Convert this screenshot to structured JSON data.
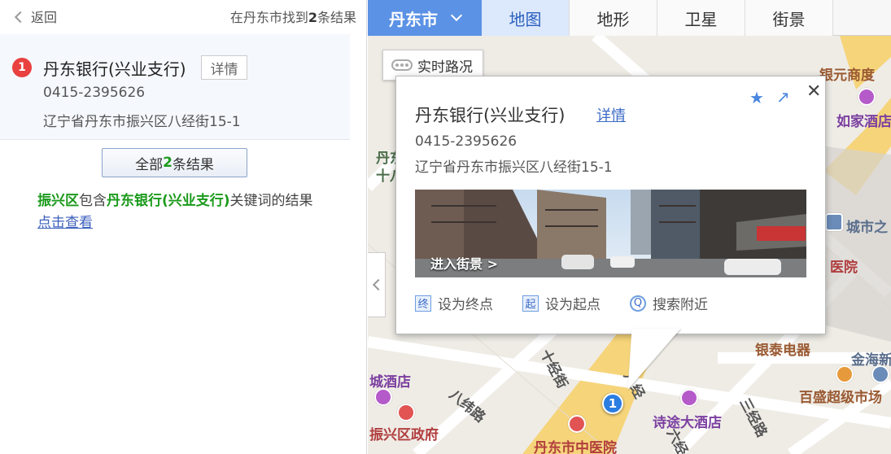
{
  "left_panel": {
    "back_label": "返回",
    "found_prefix": "在丹东市找到",
    "found_count": "2",
    "found_suffix": "条结果"
  },
  "result": {
    "index": "1",
    "name": "丹东银行(兴业支行)",
    "detail_label": "详情",
    "phone": "0415-2395626",
    "address": "辽宁省丹东市振兴区八经街15-1"
  },
  "all_results": {
    "prefix": "全部",
    "count": "2",
    "suffix": "条结果"
  },
  "keyword_note": {
    "district": "振兴区",
    "text1": "包含",
    "keyword": "丹东银行(兴业支行)",
    "text2": "关键词的结果",
    "link": "点击查看"
  },
  "map": {
    "city": "丹东市",
    "tabs": [
      "地图",
      "地形",
      "卫星",
      "街景"
    ],
    "active_tab": "地图",
    "traffic_label": "实时路况",
    "labels": {
      "mall": "银元商度",
      "hotel_rujia": "如家酒店",
      "city_of": "城市之",
      "hospital": "医院",
      "yintai": "银泰电器",
      "jinhai": "金海新",
      "baisheng": "百盛超级市场",
      "city_hotel": "城酒店",
      "zhenxing_gov": "振兴区政府",
      "shitu_hotel": "诗途大酒店",
      "tcm_hospital": "丹东市中医院",
      "dan_fragment": "丹东",
      "shi_fragment": "十八"
    },
    "roads": {
      "shijing": "十经街",
      "bawei": "八纬路",
      "bajing": "八经",
      "sanjing": "三经路",
      "liujing": "六经"
    },
    "marker_label": "1"
  },
  "popup": {
    "name": "丹东银行(兴业支行)",
    "detail_label": "详情",
    "phone": "0415-2395626",
    "address": "辽宁省丹东市振兴区八经街15-1",
    "street_view_label": "进入街景 >",
    "actions": [
      {
        "icon": "终",
        "label": "设为终点"
      },
      {
        "icon": "起",
        "label": "设为起点"
      },
      {
        "icon": "Q",
        "label": "搜索附近"
      }
    ]
  },
  "colors": {
    "city_bg": "#5b92e5",
    "active_tab_bg": "#dce8fb",
    "badge_red": "#e9413f",
    "marker_blue": "#2a7de1",
    "highlight_green": "#1b9a1b"
  }
}
